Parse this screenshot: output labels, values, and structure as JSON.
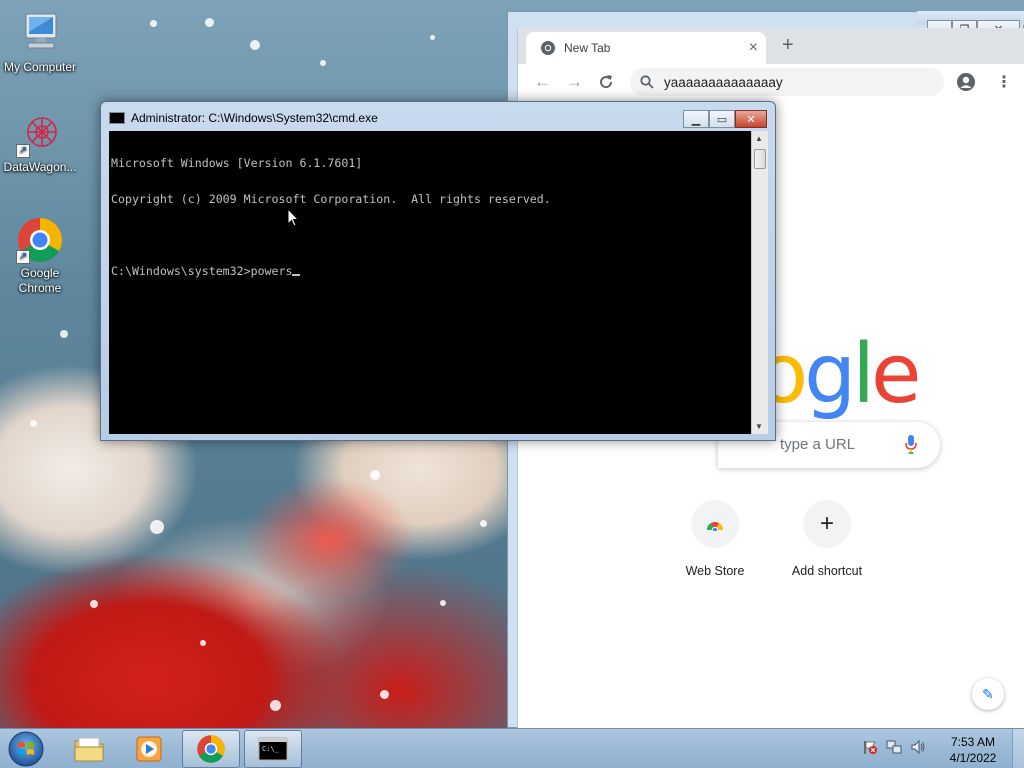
{
  "desktop": {
    "icons": [
      {
        "label": "My Computer",
        "icon": "computer-icon"
      },
      {
        "label": "DataWagon...",
        "icon": "datawagon-icon"
      },
      {
        "label": "Google Chrome",
        "icon": "chrome-icon"
      }
    ]
  },
  "chrome": {
    "tab_title": "New Tab",
    "omnibox_text": "yaaaaaaaaaaaaaay",
    "search_placeholder": "type a URL",
    "logo_visible": "ogle",
    "shortcuts": [
      {
        "label": "Web Store",
        "icon": "web-store-icon"
      },
      {
        "label": "Add shortcut",
        "icon": "plus-icon",
        "glyph": "+"
      }
    ],
    "colors": {
      "blue": "#4285f4",
      "red": "#ea4335",
      "yellow": "#fbbc05",
      "green": "#34a853"
    }
  },
  "cmd": {
    "title": "Administrator: C:\\Windows\\System32\\cmd.exe",
    "lines": [
      "Microsoft Windows [Version 6.1.7601]",
      "Copyright (c) 2009 Microsoft Corporation.  All rights reserved.",
      "",
      "C:\\Windows\\system32>powers"
    ]
  },
  "taskbar": {
    "clock_time": "7:53 AM",
    "clock_date": "4/1/2022",
    "pinned": [
      {
        "name": "explorer",
        "icon": "folder-icon"
      },
      {
        "name": "media-player",
        "icon": "media-player-icon"
      },
      {
        "name": "chrome",
        "icon": "chrome-icon"
      },
      {
        "name": "cmd",
        "icon": "cmd-icon"
      }
    ]
  }
}
